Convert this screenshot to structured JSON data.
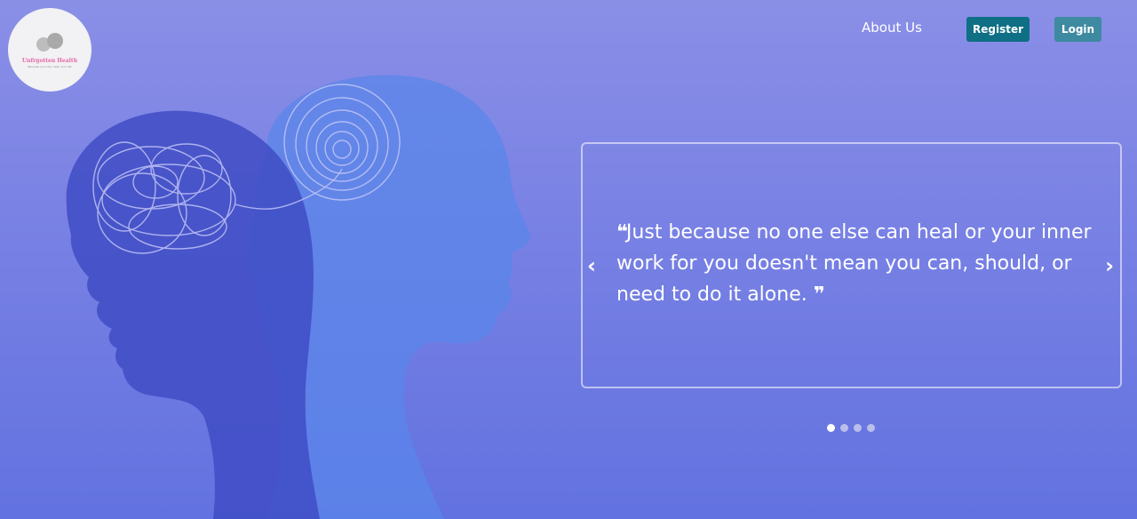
{
  "brand": {
    "name": "Unfrgotten Health",
    "tagline": "Because you care, heal, your life",
    "logo_icon": "two-heads-icon",
    "accent": "#e46aa8"
  },
  "nav": {
    "about_label": "About Us",
    "register_label": "Register",
    "login_label": "Login",
    "register_color": "#0e6f85",
    "login_color": "#3e8aa1"
  },
  "hero": {
    "background_art": "two-head-silhouettes-tangled-and-spiral",
    "carousel": {
      "open_quote": "❝",
      "quote_text": "Just because no one else can heal or your inner work for you doesn't mean you can, should, or need to do it alone. ",
      "close_quote": "❞",
      "prev_label": "‹",
      "next_label": "›",
      "slide_count": 4,
      "active_index": 0
    }
  }
}
